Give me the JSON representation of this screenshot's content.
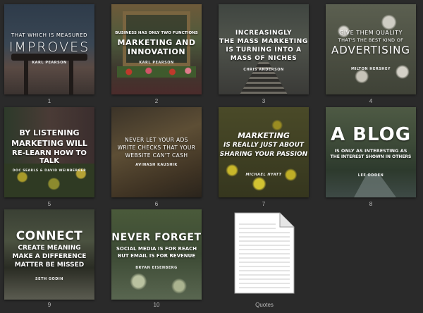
{
  "tiles": [
    {
      "label": "1",
      "line1": "THAT WHICH IS MEASURED",
      "line2": "IMPROVES",
      "author": "KARL PEARSON"
    },
    {
      "label": "2",
      "line1": "BUSINESS HAS ONLY TWO FUNCTIONS",
      "line2": "MARKETING AND",
      "line3": "INNOVATION",
      "author": "KARL PEARSON"
    },
    {
      "label": "3",
      "line1": "INCREASINGLY",
      "line2": "THE MASS MARKETING",
      "line3": "IS TURNING INTO A",
      "line4": "MASS OF NICHES",
      "author": "CHRIS ANDERSON"
    },
    {
      "label": "4",
      "line1": "GIVE THEM QUALITY",
      "line2": "THAT'S THE BEST KIND OF",
      "line3": "ADVERTISING",
      "author": "MILTON HERSHEY"
    },
    {
      "label": "5",
      "line1": "BY LISTENING",
      "line2": "MARKETING WILL",
      "line3": "RE-LEARN HOW TO TALK",
      "author": "DOC SEARLS & DAVID WEINBERGER"
    },
    {
      "label": "6",
      "line1": "NEVER LET YOUR ADS",
      "line2": "WRITE CHECKS THAT YOUR",
      "line3": "WEBSITE CAN'T CASH",
      "author": "AVINASH KAUSHIK"
    },
    {
      "label": "7",
      "line1": "MARKETING",
      "line2": "IS REALLY JUST ABOUT",
      "line3": "SHARING YOUR PASSION",
      "author": "MICHAEL HYATT"
    },
    {
      "label": "8",
      "line1": "A BLOG",
      "line2": "IS ONLY AS INTERESTING AS",
      "line3": "THE INTEREST SHOWN IN OTHERS",
      "author": "LEE ODDEN"
    },
    {
      "label": "9",
      "line1": "CONNECT",
      "line2": "CREATE MEANING",
      "line3": "MAKE A DIFFERENCE",
      "line4": "MATTER BE MISSED",
      "author": "SETH GODIN"
    },
    {
      "label": "10",
      "line1": "NEVER FORGET",
      "line2": "SOCIAL MEDIA IS FOR REACH",
      "line3": "BUT EMAIL IS FOR REVENUE",
      "author": "BRYAN EISENBERG"
    }
  ],
  "document": {
    "label": "Quotes"
  }
}
